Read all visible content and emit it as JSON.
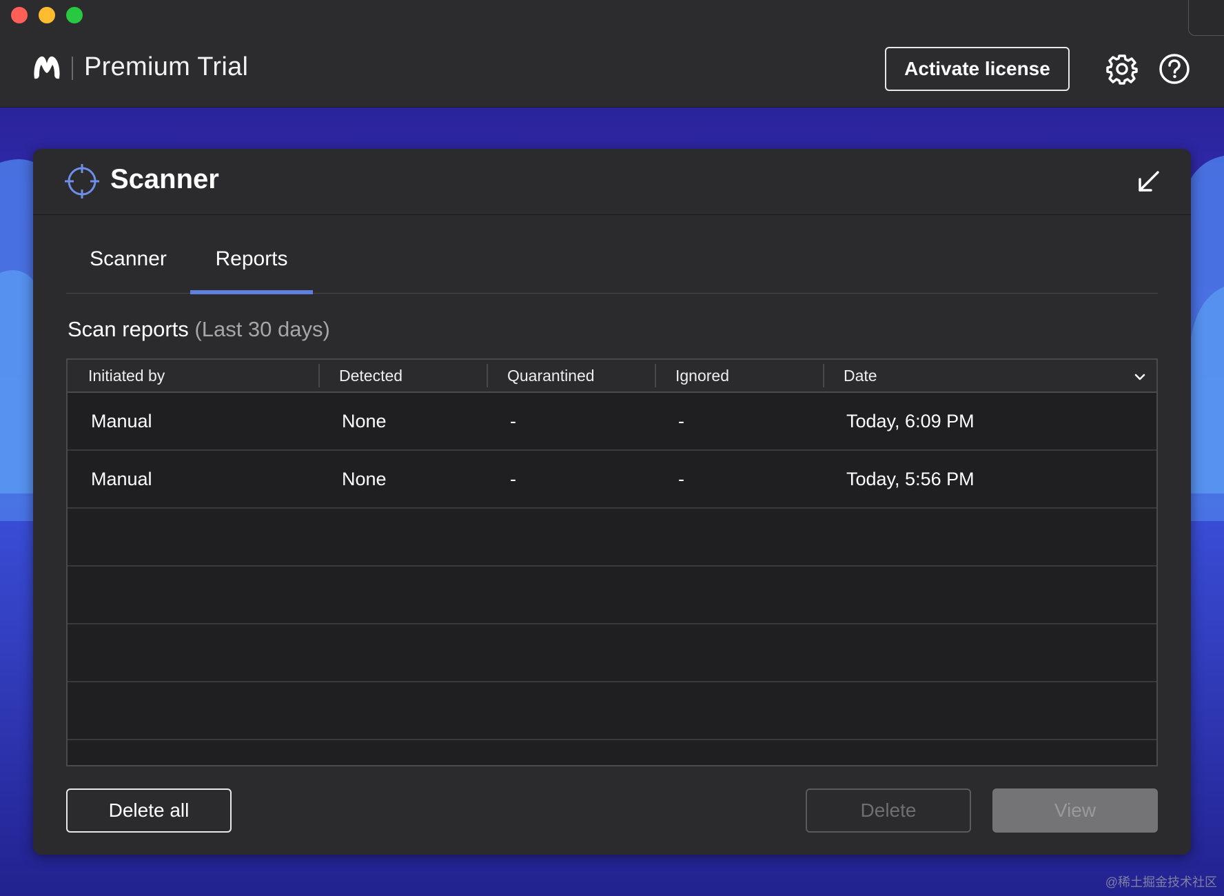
{
  "window": {
    "traffic_lights": [
      "close",
      "minimize",
      "zoom"
    ],
    "colors": {
      "close": "#ff5f57",
      "minimize": "#febc2e",
      "zoom": "#28c840"
    }
  },
  "header": {
    "product_title": "Premium Trial",
    "activate_button": "Activate license",
    "icons": [
      "malwarebytes-logo-icon",
      "gear-icon",
      "help-icon"
    ]
  },
  "panel": {
    "title": "Scanner",
    "icons": [
      "crosshair-icon",
      "collapse-arrow-icon"
    ],
    "tabs": [
      {
        "label": "Scanner",
        "active": false
      },
      {
        "label": "Reports",
        "active": true
      }
    ],
    "accent_color": "#5f7fe0"
  },
  "reports": {
    "heading": "Scan reports",
    "heading_range": "(Last 30 days)",
    "columns": [
      "Initiated by",
      "Detected",
      "Quarantined",
      "Ignored",
      "Date"
    ],
    "sort_icon": "chevron-down-icon",
    "rows": [
      {
        "initiated_by": "Manual",
        "detected": "None",
        "quarantined": "-",
        "ignored": "-",
        "date": "Today, 6:09 PM"
      },
      {
        "initiated_by": "Manual",
        "detected": "None",
        "quarantined": "-",
        "ignored": "-",
        "date": "Today, 5:56 PM"
      }
    ]
  },
  "footer": {
    "delete_all": "Delete all",
    "delete": "Delete",
    "view": "View"
  },
  "watermark": "@稀土掘金技术社区"
}
